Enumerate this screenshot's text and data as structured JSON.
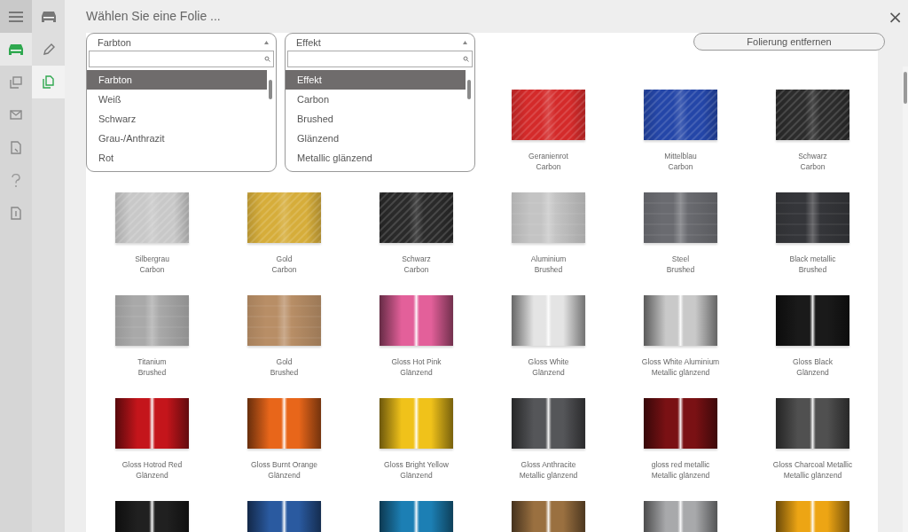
{
  "title": "Wählen Sie eine Folie ...",
  "rail": [
    {
      "selected": false
    },
    {
      "selected": true
    },
    {
      "selected": false
    },
    {
      "selected": false
    },
    {
      "selected": false
    },
    {
      "selected": false
    },
    {
      "selected": false
    }
  ],
  "subrail": [
    {
      "selected": false
    },
    {
      "selected": false
    },
    {
      "selected": true
    }
  ],
  "filters": [
    {
      "label": "Farbton",
      "options": [
        {
          "label": "Farbton",
          "selected": true
        },
        {
          "label": "Weiß",
          "selected": false
        },
        {
          "label": "Schwarz",
          "selected": false
        },
        {
          "label": "Grau-/Anthrazit",
          "selected": false
        },
        {
          "label": "Rot",
          "selected": false
        }
      ]
    },
    {
      "label": "Effekt",
      "options": [
        {
          "label": "Effekt",
          "selected": true
        },
        {
          "label": "Carbon",
          "selected": false
        },
        {
          "label": "Brushed",
          "selected": false
        },
        {
          "label": "Glänzend",
          "selected": false
        },
        {
          "label": "Metallic glänzend",
          "selected": false
        }
      ]
    }
  ],
  "remove_button": "Folierung entfernen",
  "close": "×",
  "swatches": [
    {
      "kind": "hidden"
    },
    {
      "kind": "hidden"
    },
    {
      "kind": "hidden"
    },
    {
      "kind": "carbon",
      "color": "#d42a2a",
      "name": "Geranienrot",
      "effect": "Carbon"
    },
    {
      "kind": "carbon",
      "color": "#2446a8",
      "name": "Mittelblau",
      "effect": "Carbon"
    },
    {
      "kind": "carbon",
      "color": "#2c2c2c",
      "name": "Schwarz",
      "effect": "Carbon"
    },
    {
      "kind": "carbon",
      "color": "#c8c8c8",
      "name": "Silbergrau",
      "effect": "Carbon"
    },
    {
      "kind": "carbon",
      "color": "#d6ad3a",
      "name": "Gold",
      "effect": "Carbon"
    },
    {
      "kind": "carbon",
      "color": "#2a2a2a",
      "name": "Schwarz",
      "effect": "Carbon"
    },
    {
      "kind": "brushed",
      "color": "#c4c4c4",
      "name": "Aluminium",
      "effect": "Brushed"
    },
    {
      "kind": "brushed",
      "color": "#6a6b70",
      "name": "Steel",
      "effect": "Brushed"
    },
    {
      "kind": "brushed",
      "color": "#35363a",
      "name": "Black metallic",
      "effect": "Brushed"
    },
    {
      "kind": "brushed",
      "color": "#a9a9a9",
      "name": "Titanium",
      "effect": "Brushed"
    },
    {
      "kind": "brushed",
      "color": "#b88e66",
      "name": "Gold",
      "effect": "Brushed"
    },
    {
      "kind": "gloss",
      "color": "#e3609a",
      "name": "Gloss Hot Pink",
      "effect": "Glänzend"
    },
    {
      "kind": "gloss",
      "color": "#e4e4e4",
      "name": "Gloss White",
      "effect": "Glänzend"
    },
    {
      "kind": "gloss",
      "color": "#c9c9c9",
      "name": "Gloss White Aluminium",
      "effect": "Metallic glänzend"
    },
    {
      "kind": "gloss",
      "color": "#1a1a1a",
      "name": "Gloss Black",
      "effect": "Glänzend"
    },
    {
      "kind": "gloss",
      "color": "#c4151b",
      "name": "Gloss Hotrod Red",
      "effect": "Glänzend"
    },
    {
      "kind": "gloss",
      "color": "#e8661a",
      "name": "Gloss Burnt Orange",
      "effect": "Glänzend"
    },
    {
      "kind": "gloss",
      "color": "#f0c21a",
      "name": "Gloss Bright Yellow",
      "effect": "Glänzend"
    },
    {
      "kind": "gloss",
      "color": "#555659",
      "name": "Gloss Anthracite",
      "effect": "Metallic glänzend"
    },
    {
      "kind": "gloss",
      "color": "#7a1114",
      "name": "gloss red metallic",
      "effect": "Metallic glänzend"
    },
    {
      "kind": "gloss",
      "color": "#505050",
      "name": "Gloss Charcoal Metallic",
      "effect": "Metallic glänzend"
    },
    {
      "kind": "gloss",
      "color": "#202020"
    },
    {
      "kind": "gloss",
      "color": "#2a5aa0"
    },
    {
      "kind": "gloss",
      "color": "#1c7fb4"
    },
    {
      "kind": "gloss",
      "color": "#9a7040"
    },
    {
      "kind": "gloss",
      "color": "#a8a9ab"
    },
    {
      "kind": "gloss",
      "color": "#eda514"
    }
  ]
}
